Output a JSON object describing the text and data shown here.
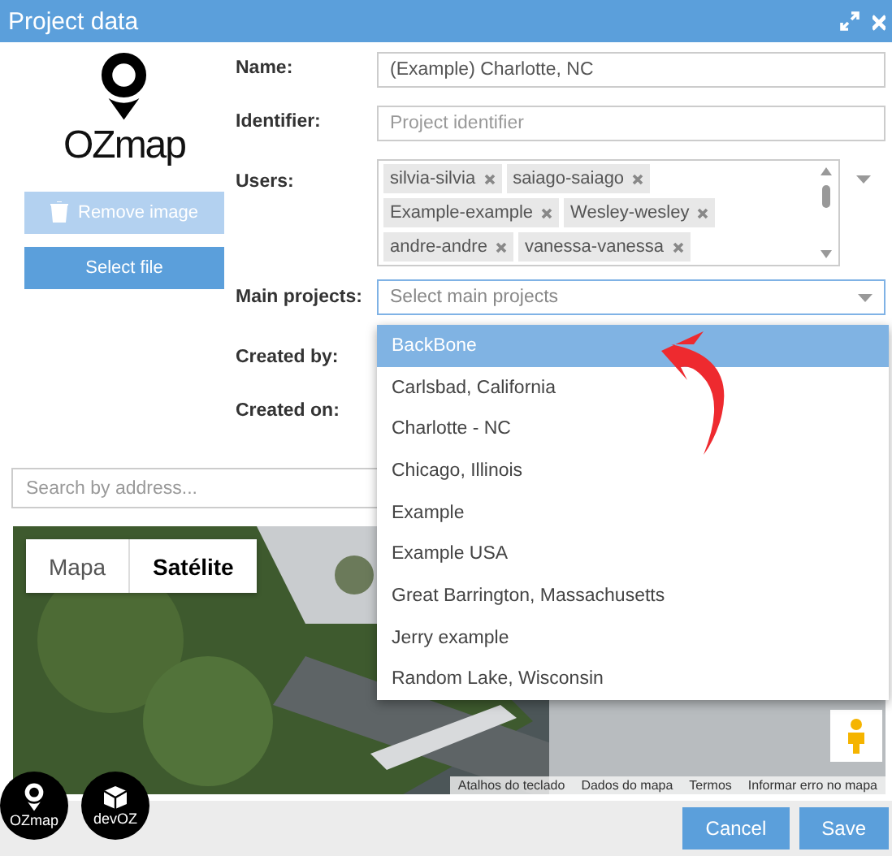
{
  "window": {
    "title": "Project data"
  },
  "logo": {
    "text": "OZmap"
  },
  "image_buttons": [
    {
      "label": "Remove image",
      "disabled": true
    },
    {
      "label": "Select file",
      "disabled": false
    }
  ],
  "fields": [
    {
      "kind": "text",
      "label": "Name:",
      "value": "(Example) Charlotte, NC"
    },
    {
      "kind": "text",
      "label": "Identifier:",
      "placeholder": "Project identifier"
    },
    {
      "kind": "tags",
      "label": "Users:",
      "tags": [
        "silvia-silvia",
        "saiago-saiago",
        "Example-example",
        "Wesley-wesley",
        "andre-andre",
        "vanessa-vanessa"
      ]
    },
    {
      "kind": "select",
      "label": "Main projects:",
      "placeholder": "Select main projects",
      "expanded": true
    },
    {
      "kind": "static",
      "label": "Created by:"
    },
    {
      "kind": "static",
      "label": "Created on:"
    }
  ],
  "dropdown": {
    "options": [
      {
        "label": "BackBone",
        "selected": true
      },
      {
        "label": "Carlsbad, California",
        "selected": false
      },
      {
        "label": "Charlotte - NC",
        "selected": false
      },
      {
        "label": "Chicago, Illinois",
        "selected": false
      },
      {
        "label": "Example",
        "selected": false
      },
      {
        "label": "Example USA",
        "selected": false
      },
      {
        "label": "Great Barrington, Massachusetts",
        "selected": false
      },
      {
        "label": "Jerry example",
        "selected": false
      },
      {
        "label": "Random Lake, Wisconsin",
        "selected": false
      }
    ]
  },
  "search": {
    "placeholder": "Search by address..."
  },
  "map": {
    "tabs": [
      {
        "label": "Mapa",
        "selected": false
      },
      {
        "label": "Satélite",
        "selected": true
      }
    ],
    "attribution": [
      "Atalhos do teclado",
      "Dados do mapa",
      "Termos",
      "Informar erro no mapa"
    ]
  },
  "badges": [
    "OZmap",
    "devOZ"
  ],
  "footer": {
    "buttons": [
      "Cancel",
      "Save"
    ]
  }
}
